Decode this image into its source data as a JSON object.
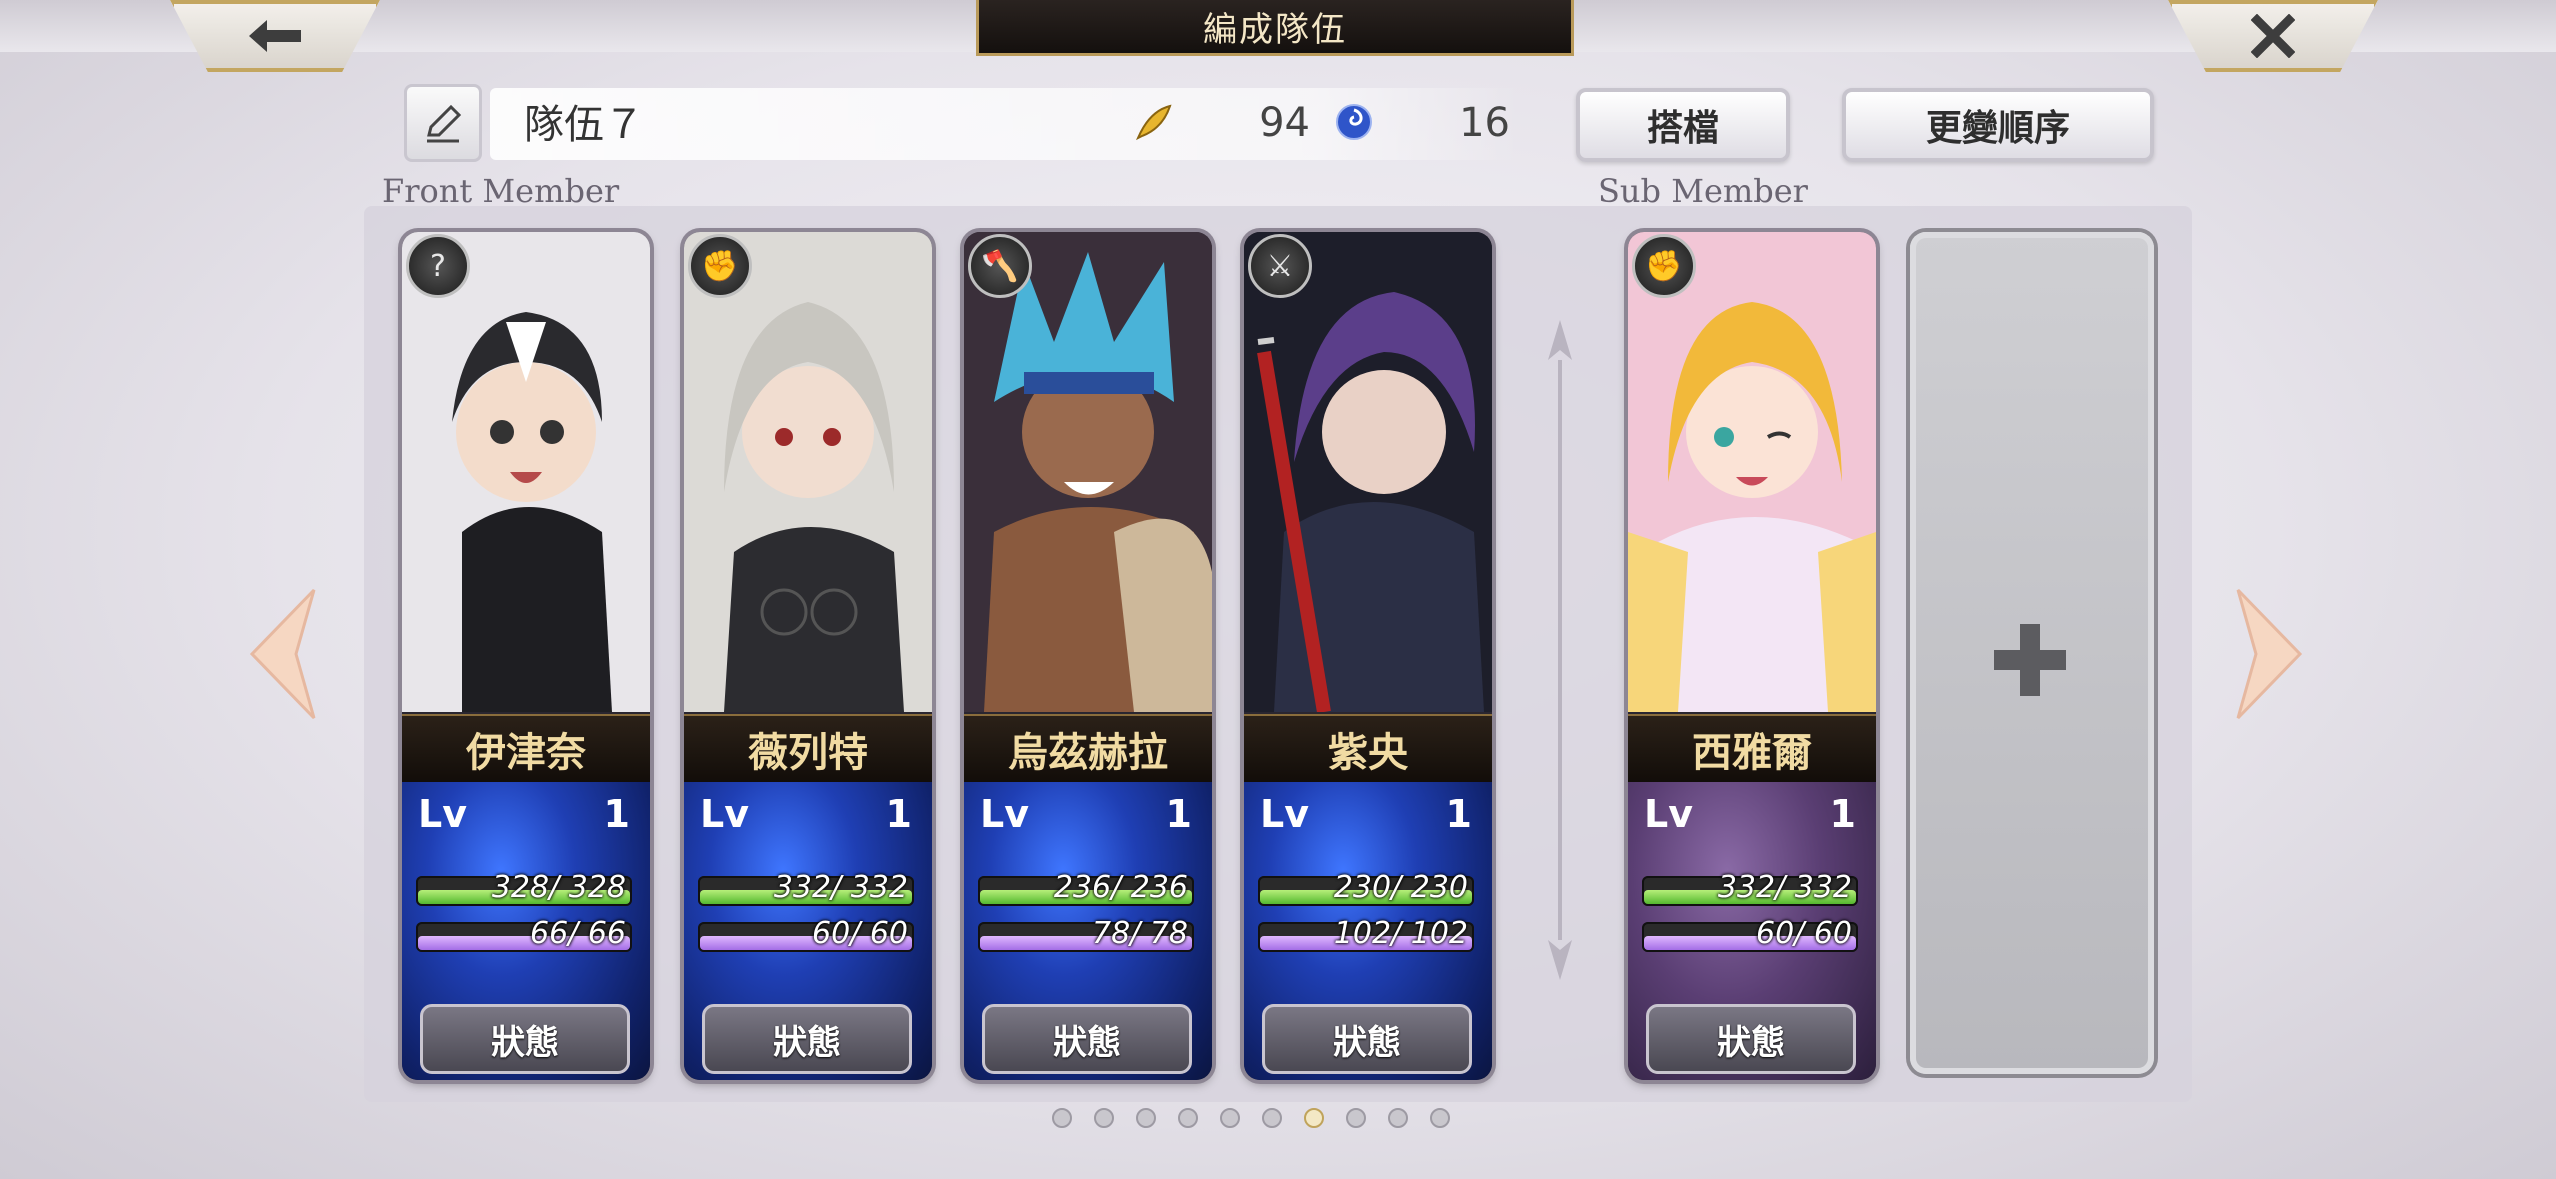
{
  "header": {
    "title": "編成隊伍",
    "back_icon": "arrow-left-icon",
    "close_icon": "close-icon"
  },
  "team": {
    "name": "隊伍７",
    "feather_value": "94",
    "swirl_value": "16",
    "partner_label": "搭檔",
    "order_label": "更變順序"
  },
  "sections": {
    "front_label": "Front Member",
    "sub_label": "Sub Member"
  },
  "front_members": [
    {
      "name": "伊津奈",
      "lv_label": "Lv",
      "lv": "1",
      "hp": "328/ 328",
      "hp_frac": 1.0,
      "mp": "66/ 66",
      "mp_frac": 1.0,
      "status_label": "狀態",
      "class_icon": "question-icon"
    },
    {
      "name": "薇列特",
      "lv_label": "Lv",
      "lv": "1",
      "hp": "332/ 332",
      "hp_frac": 1.0,
      "mp": "60/ 60",
      "mp_frac": 1.0,
      "status_label": "狀態",
      "class_icon": "gauntlet-icon"
    },
    {
      "name": "烏茲赫拉",
      "lv_label": "Lv",
      "lv": "1",
      "hp": "236/ 236",
      "hp_frac": 1.0,
      "mp": "78/ 78",
      "mp_frac": 1.0,
      "status_label": "狀態",
      "class_icon": "axe-icon"
    },
    {
      "name": "紫央",
      "lv_label": "Lv",
      "lv": "1",
      "hp": "230/ 230",
      "hp_frac": 1.0,
      "mp": "102/ 102",
      "mp_frac": 1.0,
      "status_label": "狀態",
      "class_icon": "sword-icon"
    }
  ],
  "sub_members": [
    {
      "name": "西雅爾",
      "lv_label": "Lv",
      "lv": "1",
      "hp": "332/ 332",
      "hp_frac": 1.0,
      "mp": "60/ 60",
      "mp_frac": 1.0,
      "status_label": "狀態",
      "class_icon": "gauntlet-icon"
    }
  ],
  "pager": {
    "count": 10,
    "active_index": 6
  },
  "colors": {
    "gold": "#c3a660",
    "hp": "#54b82f",
    "mp": "#a46ee6"
  }
}
